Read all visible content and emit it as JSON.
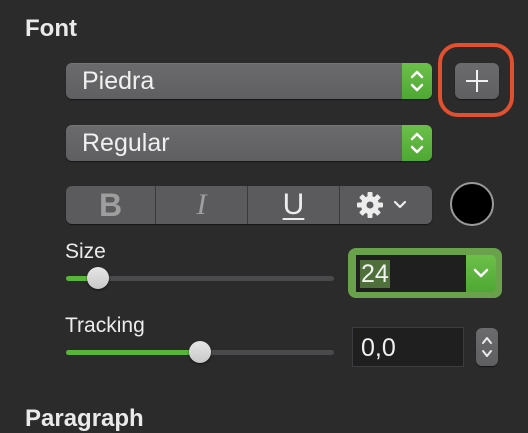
{
  "font_section": {
    "title": "Font"
  },
  "font_family": {
    "value": "Piedra"
  },
  "font_style": {
    "value": "Regular"
  },
  "style_buttons": {
    "bold": "B",
    "italic": "I",
    "underline": "U"
  },
  "text_color": "#000000",
  "size": {
    "label": "Size",
    "value": "24",
    "slider_fraction": 0.12
  },
  "tracking": {
    "label": "Tracking",
    "value": "0,0",
    "slider_fraction": 0.5
  },
  "paragraph_section": {
    "title": "Paragraph"
  },
  "icons": {
    "stepper": "up-down-chevron-icon",
    "add": "plus-icon",
    "gear": "gear-icon",
    "dropdown": "chevron-down-icon"
  },
  "colors": {
    "accent": "#59b43a",
    "highlight": "#e3502f",
    "background": "#2b2b2c"
  }
}
